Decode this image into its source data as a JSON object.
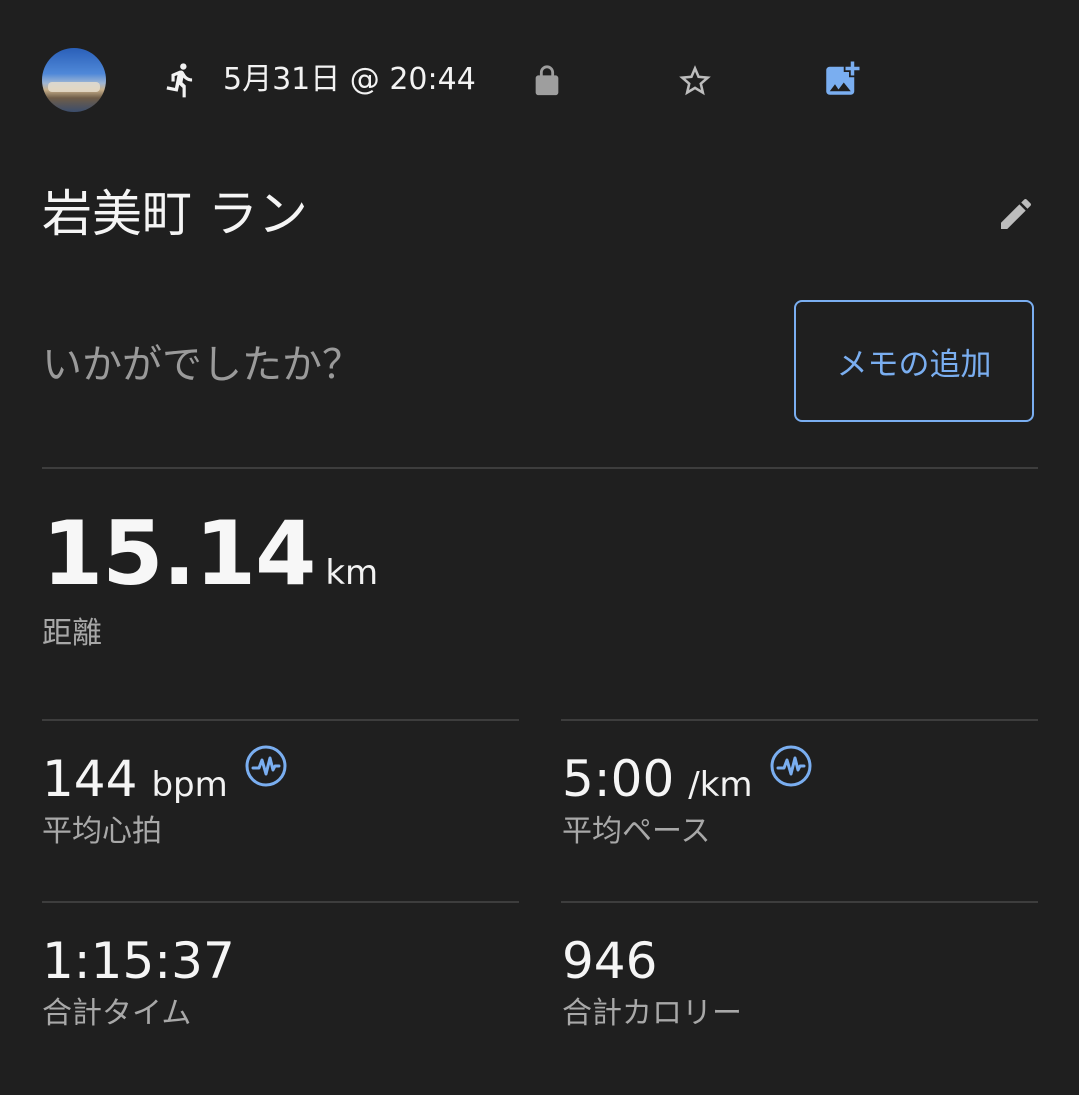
{
  "header": {
    "avatar_icon": "profile-photo",
    "activity_icon": "running-icon",
    "date_time": "5月31日 @ 20:44",
    "privacy_icon": "lock-icon",
    "favorite_icon": "star-icon",
    "add_photo_icon": "add-photo-icon"
  },
  "activity": {
    "title": "岩美町 ラン",
    "edit_icon": "pencil-icon"
  },
  "memo": {
    "prompt": "いかがでしたか？",
    "button_label": "メモの追加"
  },
  "distance": {
    "value": "15.14",
    "unit": "km",
    "label": "距離"
  },
  "stats": {
    "heart_rate": {
      "value": "144",
      "unit": "bpm",
      "label": "平均心拍"
    },
    "pace": {
      "value": "5:00",
      "unit": "/km",
      "label": "平均ペース"
    },
    "total_time": {
      "value": "1:15:37",
      "label": "合計タイム"
    },
    "calories": {
      "value": "946",
      "label": "合計カロリー"
    }
  },
  "colors": {
    "background": "#1f1f1f",
    "accent": "#7aaef0",
    "divider": "#3d3d3d",
    "secondary_text": "#a8a8a8"
  }
}
